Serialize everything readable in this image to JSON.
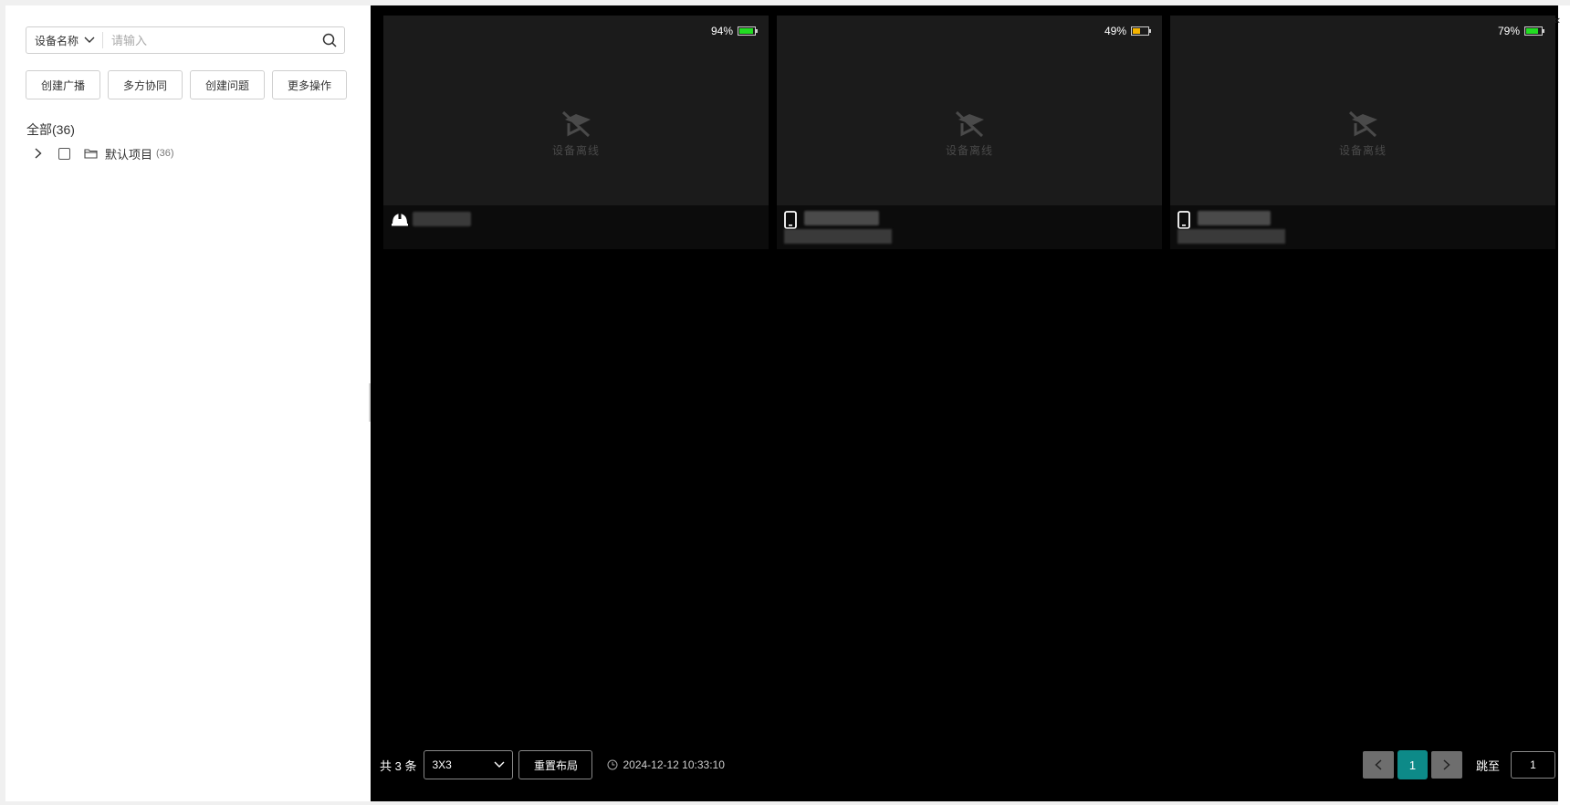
{
  "sidebar": {
    "search": {
      "field": "设备名称",
      "placeholder": "请输入"
    },
    "actions": [
      "创建广播",
      "多方协同",
      "创建问题",
      "更多操作"
    ],
    "all_label": "全部(36)",
    "tree": [
      {
        "name": "默认项目",
        "count": "(36)"
      }
    ]
  },
  "tiles": [
    {
      "battery": "94%",
      "battery_level": 0.94,
      "battery_color": "#22dd22",
      "device_icon": "helmet-icon",
      "offline_text": "设备离线"
    },
    {
      "battery": "49%",
      "battery_level": 0.49,
      "battery_color": "#f5b400",
      "device_icon": "phone-icon",
      "offline_text": "设备离线"
    },
    {
      "battery": "79%",
      "battery_level": 0.79,
      "battery_color": "#22dd22",
      "device_icon": "phone-icon",
      "offline_text": "设备离线"
    }
  ],
  "bottom": {
    "total": "共 3 条",
    "layout": "3X3",
    "reset": "重置布局",
    "timestamp": "2024-12-12 10:33:10"
  },
  "pager": {
    "current_page": "1",
    "jump_label": "跳至",
    "jump_value": "1"
  },
  "colors": {
    "accent": "#0d8a88"
  }
}
